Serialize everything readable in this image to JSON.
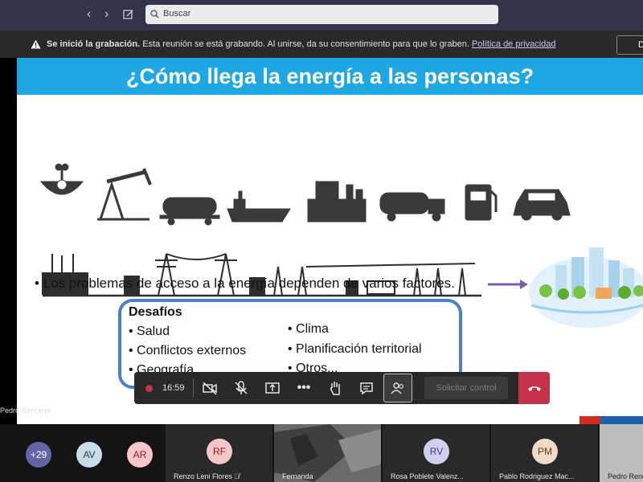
{
  "search": {
    "placeholder": "Buscar"
  },
  "notice": {
    "bold": "Se inició la grabación.",
    "text": "Esta reunión se está grabando. Al unirse, da su consentimiento para que lo graben.",
    "link": "Política de privacidad",
    "dismiss": "De"
  },
  "slide": {
    "title": "¿Cómo llega la energía a las personas?",
    "bullet": "• Los problemas de acceso a la energía dependen de varios factores.",
    "box_title": "Desafíos",
    "left_items": [
      "•   Salud",
      "•   Conflictos externos",
      "•   Geografía"
    ],
    "right_items": [
      "•   Clima",
      "•   Planificación territorial",
      "•   Otros..."
    ]
  },
  "presenter_label": "Pedro Rencoret",
  "meeting": {
    "timer": "16:59",
    "control_label": "Solicitar control",
    "accent": "#c4314b"
  },
  "participants": {
    "more": "+29",
    "avatars": [
      "AV",
      "AR"
    ],
    "tiles": [
      {
        "initials": "RF",
        "name": "Renzo Leni Flores"
      },
      {
        "initials": "",
        "name": "Fernanda"
      },
      {
        "initials": "RV",
        "name": "Rosa Poblete Valenz..."
      },
      {
        "initials": "PM",
        "name": "Pablo Rodriguez Mac..."
      },
      {
        "initials": "",
        "name": "Pedro Rend"
      }
    ]
  }
}
